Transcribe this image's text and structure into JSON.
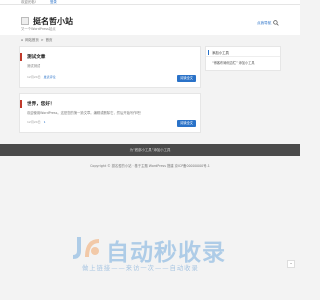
{
  "topbar": {
    "greeting": "欢迎光临!",
    "login": "登录"
  },
  "header": {
    "site_title": "挺名哲小站",
    "site_desc": "又一个WordPress站点",
    "nav_link": "点我导航"
  },
  "breadcrumb": {
    "home": "网站首页",
    "sep": ">",
    "current": "首页"
  },
  "posts": [
    {
      "title": "测试文章",
      "excerpt": "测试测试",
      "date": "12月24日",
      "comment": "发表评论",
      "read_more": "阅读全文"
    },
    {
      "title": "世界，您好！",
      "excerpt": "欢迎使用WordPress。这是您的第一篇文章。编辑或删除它，然后开始写作吧！",
      "date": "12月24日",
      "comment": "1",
      "read_more": "阅读全文"
    }
  ],
  "sidebar": {
    "widget_title": "添加小工具",
    "widget_text": "“博客布局侧边栏” 添加小工具"
  },
  "footer": {
    "notice": "为“底部小工具”添加小工具",
    "copyright": "Copyright © 挺名哲的小站 · 基于主题 WordPress 搭建 京ICP备00000000号-1"
  },
  "watermark": {
    "title": "自动秒收录",
    "subtitle": "做上链接——来访一次——自动收录"
  }
}
